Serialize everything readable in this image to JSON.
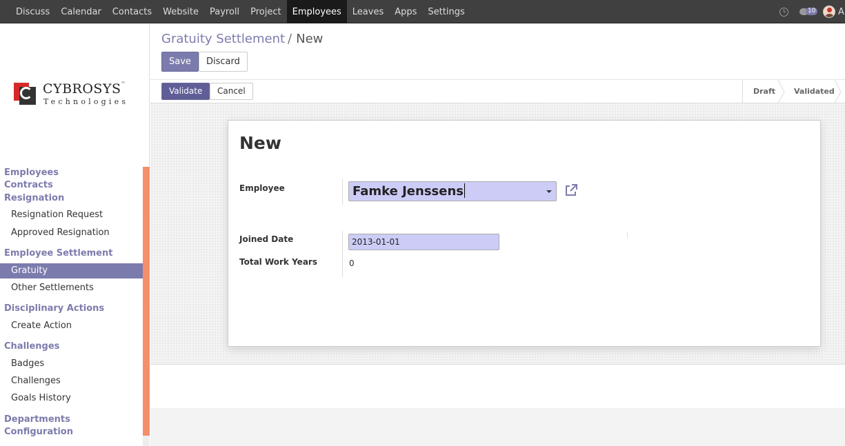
{
  "topbar": {
    "menu": [
      "Discuss",
      "Calendar",
      "Contacts",
      "Website",
      "Payroll",
      "Project",
      "Employees",
      "Leaves",
      "Apps",
      "Settings"
    ],
    "active": "Employees",
    "chat_count": "10",
    "user_initial": "A"
  },
  "logo": {
    "title": "CYBROSYS",
    "tm": "™",
    "subtitle": "Technologies"
  },
  "sidebar": {
    "employees": "Employees",
    "contracts": "Contracts",
    "resignation": "Resignation",
    "resignation_request": "Resignation Request",
    "approved_resignation": "Approved Resignation",
    "employee_settlement": "Employee Settlement",
    "gratuity": "Gratuity",
    "other_settlements": "Other Settlements",
    "disciplinary_actions": "Disciplinary Actions",
    "create_action": "Create Action",
    "challenges_header": "Challenges",
    "badges": "Badges",
    "challenges": "Challenges",
    "goals_history": "Goals History",
    "departments": "Departments",
    "configuration": "Configuration"
  },
  "breadcrumb": {
    "parent": "Gratuity Settlement",
    "separator": "/",
    "current": "New"
  },
  "buttons": {
    "save": "Save",
    "discard": "Discard",
    "validate": "Validate",
    "cancel": "Cancel"
  },
  "stages": {
    "draft": "Draft",
    "validated": "Validated"
  },
  "form": {
    "title": "New",
    "employee_label": "Employee",
    "employee_value": "Famke Jenssens",
    "joined_date_label": "Joined Date",
    "joined_date_value": "2013-01-01",
    "total_work_years_label": "Total Work Years",
    "total_work_years_value": "0"
  },
  "colors": {
    "brand": "#7c7bad",
    "navbar": "#404040",
    "scrollbar": "#f48f6a",
    "input_highlight": "#ccccf7"
  }
}
